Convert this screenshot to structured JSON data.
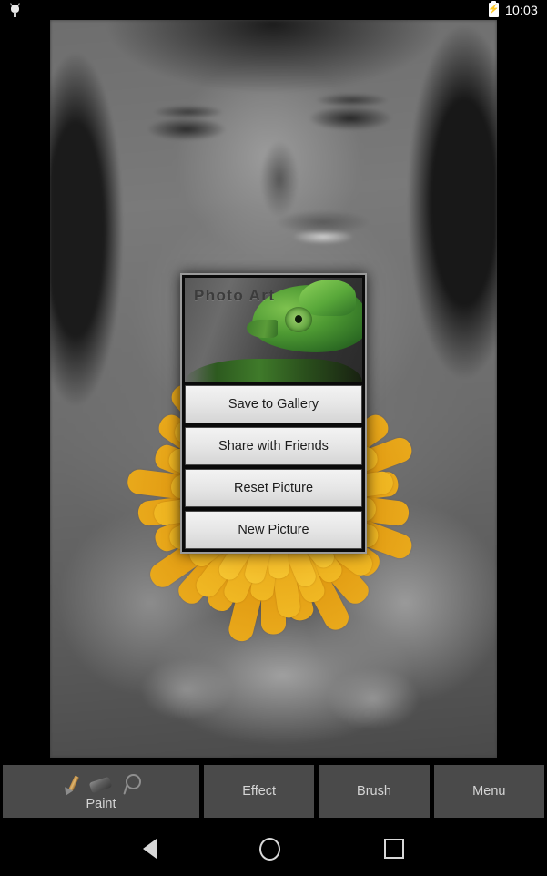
{
  "status_bar": {
    "notification_icon": "android-bug-icon",
    "battery_icon": "battery-charging-icon",
    "battery_glyph": "⚡",
    "time": "10:03"
  },
  "canvas": {
    "photo_description": "grayscale portrait of a woman holding a colorized orange gerbera daisy"
  },
  "dialog": {
    "title": "Photo Art",
    "header_image": "chameleon-photo",
    "buttons": [
      {
        "label": "Save to Gallery",
        "name": "save-to-gallery-button"
      },
      {
        "label": "Share with Friends",
        "name": "share-with-friends-button"
      },
      {
        "label": "Reset Picture",
        "name": "reset-picture-button"
      },
      {
        "label": "New Picture",
        "name": "new-picture-button"
      }
    ]
  },
  "toolbar": {
    "paint": {
      "label": "Paint",
      "icons": [
        "pencil-icon",
        "eraser-icon",
        "magnifier-icon"
      ]
    },
    "effect_label": "Effect",
    "brush_label": "Brush",
    "menu_label": "Menu"
  },
  "navbar": {
    "back": "back-icon",
    "home": "home-icon",
    "recents": "recents-icon"
  },
  "colors": {
    "background": "#000000",
    "dialog_border": "#9a9a9a",
    "button_face": "#e6e6e6",
    "toolbar_button": "#4a4a4a",
    "flower_accent": "#e8a81a",
    "chameleon_green": "#4e9a33"
  }
}
